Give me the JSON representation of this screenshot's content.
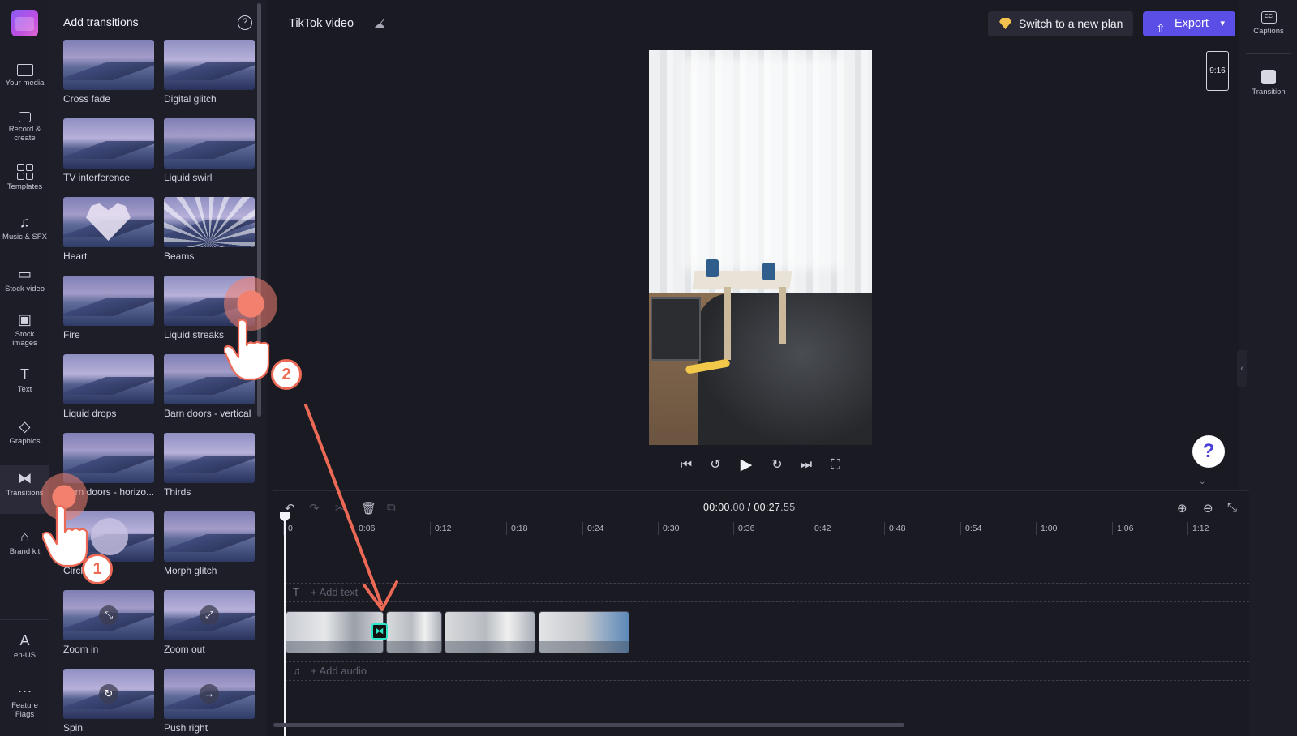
{
  "app": {
    "project_name": "TikTok video"
  },
  "left_rail": {
    "items": [
      {
        "label": "Your media",
        "icon": "folder-icon"
      },
      {
        "label": "Record & create",
        "icon": "camera-icon"
      },
      {
        "label": "Templates",
        "icon": "templates-icon"
      },
      {
        "label": "Music & SFX",
        "icon": "music-icon"
      },
      {
        "label": "Stock video",
        "icon": "film-icon"
      },
      {
        "label": "Stock images",
        "icon": "image-icon"
      },
      {
        "label": "Text",
        "icon": "text-icon"
      },
      {
        "label": "Graphics",
        "icon": "graphics-icon"
      },
      {
        "label": "Transitions",
        "icon": "transition-icon"
      },
      {
        "label": "Brand kit",
        "icon": "brand-kit-icon"
      },
      {
        "label": "en-US",
        "icon": "language-icon"
      },
      {
        "label": "Feature Flags",
        "icon": "more-icon"
      }
    ],
    "active": "Transitions"
  },
  "panel": {
    "title": "Add transitions",
    "transitions": [
      "Cross fade",
      "Digital glitch",
      "TV interference",
      "Liquid swirl",
      "Heart",
      "Beams",
      "Fire",
      "Liquid streaks",
      "Liquid drops",
      "Barn doors - vertical",
      "Barn doors - horizo...",
      "Thirds",
      "Circle wipe",
      "Morph glitch",
      "Zoom in",
      "Zoom out",
      "Spin",
      "Push right"
    ]
  },
  "topbar": {
    "plan_label": "Switch to a new plan",
    "export_label": "Export"
  },
  "right_rail": {
    "items": [
      {
        "label": "Captions",
        "icon": "captions-icon"
      },
      {
        "label": "Transition",
        "icon": "transition-icon"
      }
    ]
  },
  "preview": {
    "aspect_ratio": "9:16"
  },
  "timeline": {
    "time_current": "00:00",
    "time_current_frac": ".00",
    "time_total": "00:27",
    "time_total_frac": ".55",
    "ticks": [
      "0",
      "0:06",
      "0:12",
      "0:18",
      "0:24",
      "0:30",
      "0:36",
      "0:42",
      "0:48",
      "0:54",
      "1:00",
      "1:06",
      "1:12"
    ],
    "text_lane": "+ Add text",
    "audio_lane": "+ Add audio"
  },
  "annotations": {
    "step1": "1",
    "step2": "2"
  },
  "colors": {
    "accent": "#5b4ee6",
    "annotation": "#ec6a55",
    "transition_marker": "#2ee6c8"
  }
}
